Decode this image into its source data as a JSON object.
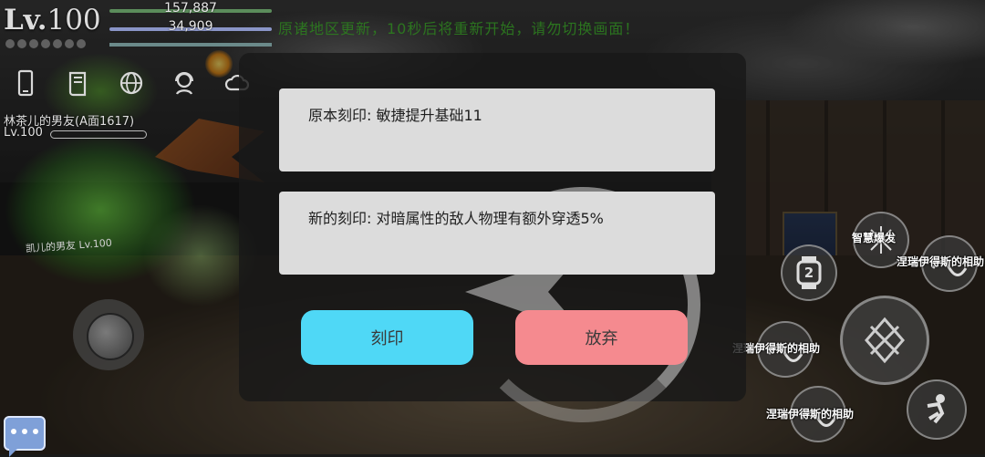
{
  "hud": {
    "level_prefix": "Lv.",
    "level_number": "100",
    "hp_value": "157,887",
    "mp_value": "34,909",
    "notice": "原诸地区更新，10秒后将重新开始，请勿切换画面！"
  },
  "top_icons": [
    "phone-icon",
    "book-icon",
    "globe-icon",
    "support-agent-icon",
    "cloud-icon"
  ],
  "party": {
    "name": "林茶儿的男友(A面1617)",
    "level": "Lv.100"
  },
  "enemy_label": "凯儿的男友 Lv.100",
  "dialog": {
    "original_label": "原本刻印: 敏捷提升基础11",
    "new_label": "新的刻印: 对暗属性的敌人物理有额外穿透5%",
    "engrave_button": "刻印",
    "abandon_button": "放弃"
  },
  "skills": {
    "wisdom_burst": "智慧爆发",
    "help_1": "涅瑞伊得斯的相助",
    "help_2": "涅瑞伊得斯的相助",
    "help_3": "涅瑞伊得斯的相助",
    "watch_number": "2"
  },
  "colors": {
    "engrave_button": "#4fd8f6",
    "abandon_button": "#f58a8f",
    "card_bg": "#dcdcdc"
  }
}
